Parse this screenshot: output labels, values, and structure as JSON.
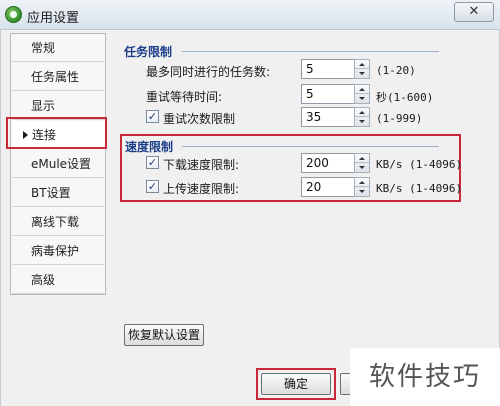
{
  "window": {
    "title": "应用设置",
    "close_glyph": "✕",
    "app_icon": "app-logo-icon"
  },
  "sidebar": {
    "items": [
      {
        "label": "常规"
      },
      {
        "label": "任务属性"
      },
      {
        "label": "显示"
      },
      {
        "label": "连接",
        "selected": true
      },
      {
        "label": "eMule设置"
      },
      {
        "label": "BT设置"
      },
      {
        "label": "离线下载"
      },
      {
        "label": "病毒保护"
      },
      {
        "label": "高级"
      }
    ]
  },
  "task_limit": {
    "title": "任务限制",
    "rows": [
      {
        "label": "最多同时进行的任务数:",
        "value": "5",
        "range": "(1-20)",
        "has_checkbox": false
      },
      {
        "label": "重试等待时间:",
        "value": "5",
        "range": "秒(1-600)",
        "has_checkbox": false
      },
      {
        "label": "重试次数限制",
        "value": "35",
        "range": "(1-999)",
        "has_checkbox": true,
        "checked": true
      }
    ]
  },
  "speed_limit": {
    "title": "速度限制",
    "rows": [
      {
        "label": "下载速度限制:",
        "value": "200",
        "range": "KB/s (1-4096)",
        "checked": true
      },
      {
        "label": "上传速度限制:",
        "value": "20",
        "range": "KB/s (1-4096)",
        "checked": true
      }
    ]
  },
  "buttons": {
    "restore_defaults": "恢复默认设置",
    "ok": "确定"
  },
  "watermark": {
    "text": "软件技巧"
  },
  "colors": {
    "highlight_box": "#c8283a",
    "group_title": "#1d3f8a"
  }
}
